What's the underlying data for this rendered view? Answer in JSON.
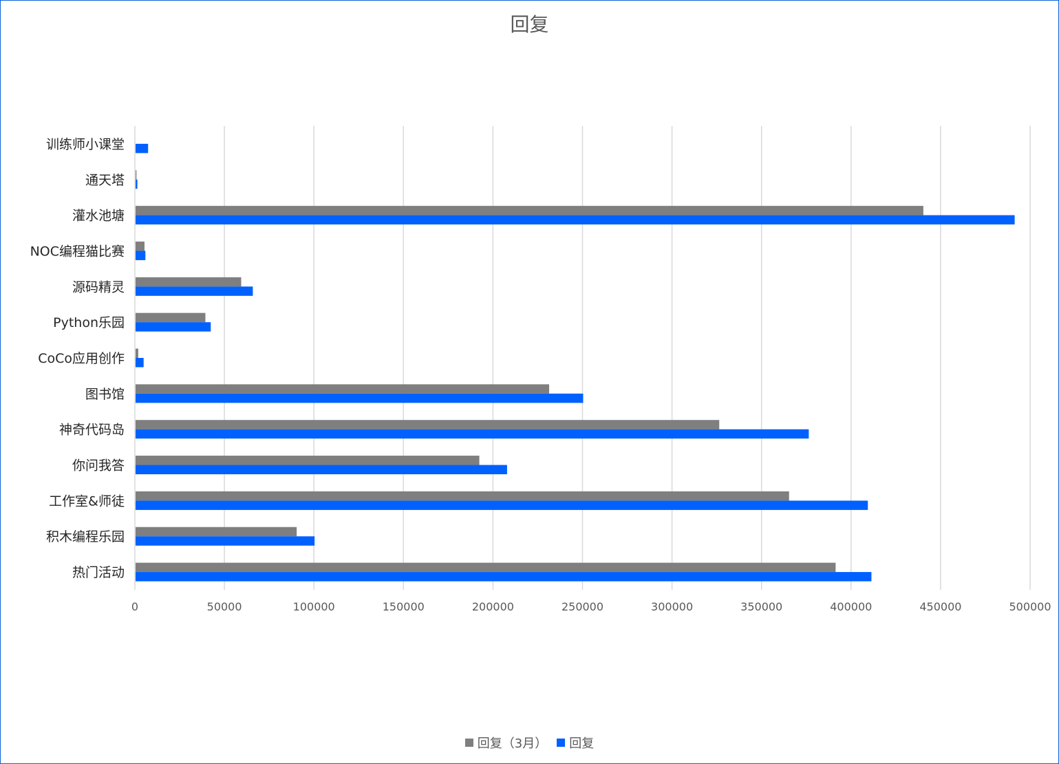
{
  "chart_data": {
    "type": "bar",
    "orientation": "horizontal",
    "title": "回复",
    "xlabel": "",
    "ylabel": "",
    "xlim": [
      0,
      500000
    ],
    "x_ticks": [
      "0",
      "50000",
      "100000",
      "150000",
      "200000",
      "250000",
      "300000",
      "350000",
      "400000",
      "450000",
      "500000"
    ],
    "grid": "vertical",
    "legend_position": "bottom",
    "categories": [
      "训练师小课堂",
      "通天塔",
      "灌水池塘",
      "NOC编程猫比赛",
      "源码精灵",
      "Python乐园",
      "CoCo应用创作",
      "图书馆",
      "神奇代码岛",
      "你问我答",
      "工作室&师徒",
      "积木编程乐园",
      "热门活动"
    ],
    "series": [
      {
        "name": "回复（3月）",
        "color": "#7f7f7f",
        "values": [
          0,
          500,
          440000,
          5000,
          59000,
          39000,
          1500,
          231000,
          326000,
          192000,
          365000,
          90000,
          391000
        ]
      },
      {
        "name": "回复",
        "color": "#0061ff",
        "values": [
          7000,
          1000,
          491000,
          5500,
          65500,
          42000,
          4500,
          250000,
          376000,
          207500,
          409000,
          100000,
          411000
        ]
      }
    ]
  }
}
